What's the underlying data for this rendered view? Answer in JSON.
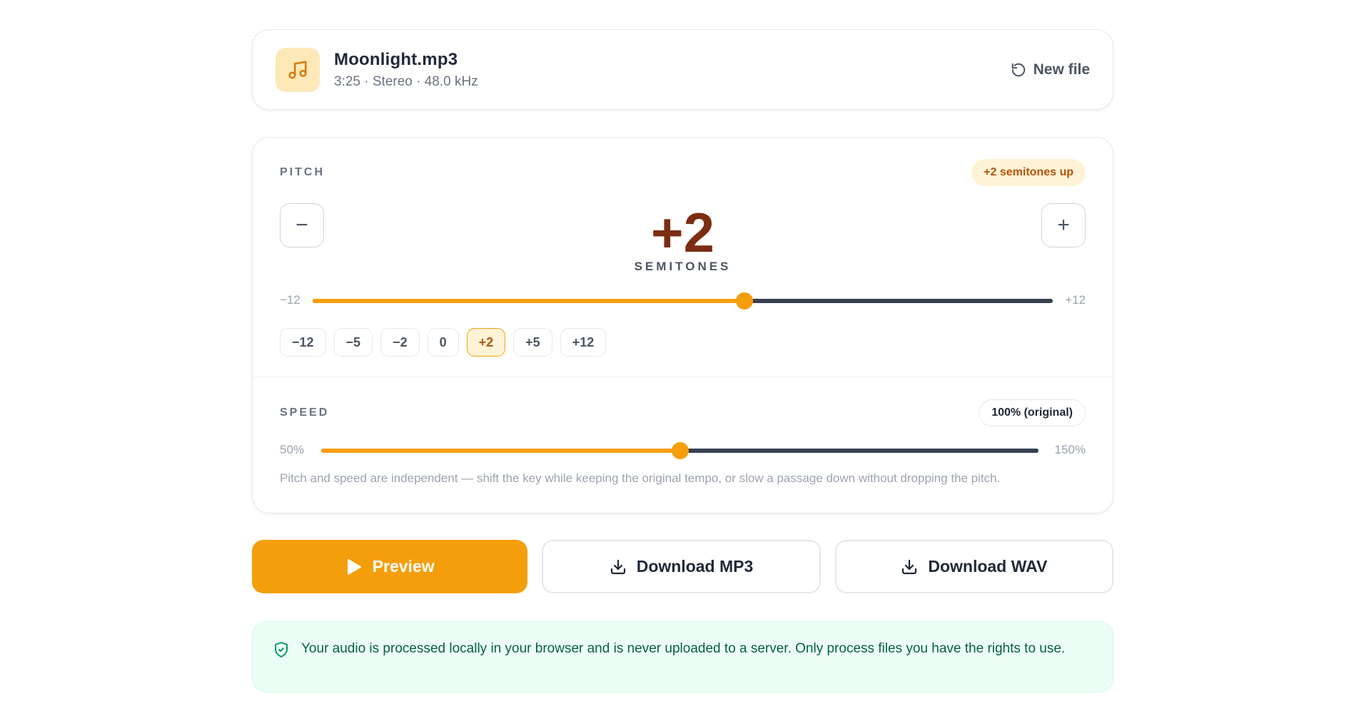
{
  "file": {
    "name": "Moonlight.mp3",
    "info": "3:25 · Stereo · 48.0 kHz",
    "new_file_label": "New file"
  },
  "pitch": {
    "label": "PITCH",
    "badge": "+2 semitones up",
    "value_display": "+2",
    "unit": "SEMITONES",
    "min_label": "−12",
    "max_label": "+12",
    "min": -12,
    "max": 12,
    "value": 2,
    "presets": [
      "−12",
      "−5",
      "−2",
      "0",
      "+2",
      "+5",
      "+12"
    ],
    "active_preset": "+2",
    "decrement_label": "−",
    "increment_label": "+"
  },
  "speed": {
    "label": "SPEED",
    "badge": "100% (original)",
    "min_label": "50%",
    "max_label": "150%",
    "min": 50,
    "max": 150,
    "value": 100,
    "note": "Pitch and speed are independent — shift the key while keeping the original tempo, or slow a passage down without dropping the pitch."
  },
  "actions": {
    "preview": "Preview",
    "download_mp3": "Download MP3",
    "download_wav": "Download WAV"
  },
  "notice": {
    "text": "Your audio is processed locally in your browser and is never uploaded to a server. Only process files you have the rights to use."
  },
  "colors": {
    "accent": "#f59e0b",
    "pitch_value": "#7c2d12",
    "notice_bg": "#ecfdf5",
    "notice_text": "#065f46"
  }
}
